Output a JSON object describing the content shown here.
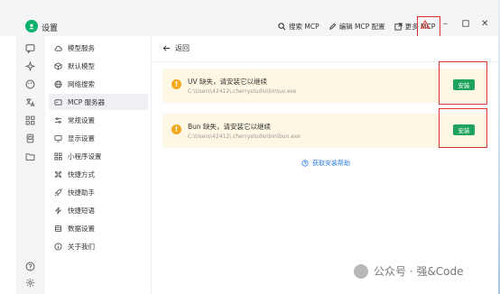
{
  "app": {
    "title": "设置"
  },
  "toolbar": {
    "search_mcp": "搜索 MCP",
    "edit_mcp_config": "编辑 MCP 配置",
    "more_mcp": "更多 MCP"
  },
  "nav": {
    "items": [
      {
        "label": "模型服务",
        "icon": "cloud-icon"
      },
      {
        "label": "默认模型",
        "icon": "cube-icon"
      },
      {
        "label": "网络搜索",
        "icon": "globe-icon"
      },
      {
        "label": "MCP 服务器",
        "icon": "server-icon"
      },
      {
        "label": "常规设置",
        "icon": "sliders-icon"
      },
      {
        "label": "显示设置",
        "icon": "monitor-icon"
      },
      {
        "label": "小程序设置",
        "icon": "grid-icon"
      },
      {
        "label": "快捷方式",
        "icon": "command-icon"
      },
      {
        "label": "快捷助手",
        "icon": "rocket-icon"
      },
      {
        "label": "快捷短语",
        "icon": "zap-icon"
      },
      {
        "label": "数据设置",
        "icon": "database-icon"
      },
      {
        "label": "关于我们",
        "icon": "info-icon"
      }
    ],
    "active_index": 3
  },
  "main": {
    "back_label": "返回",
    "cards": [
      {
        "message": "UV 缺失，请安装它以继续",
        "path": "C:\\Users\\42412\\.cherrystudio\\bin\\uv.exe",
        "button": "安装"
      },
      {
        "message": "Bun 缺失，请安装它以继续",
        "path": "C:\\Users\\42412\\.cherrystudio\\bin\\bun.exe",
        "button": "安装"
      }
    ],
    "help_link": "获取安装帮助"
  },
  "watermark": {
    "text": "公众号 · 强&Code"
  },
  "colors": {
    "accent": "#1fa35c",
    "warning": "#f2a91e",
    "annotation": "#e0322d",
    "link": "#2d7be0"
  }
}
